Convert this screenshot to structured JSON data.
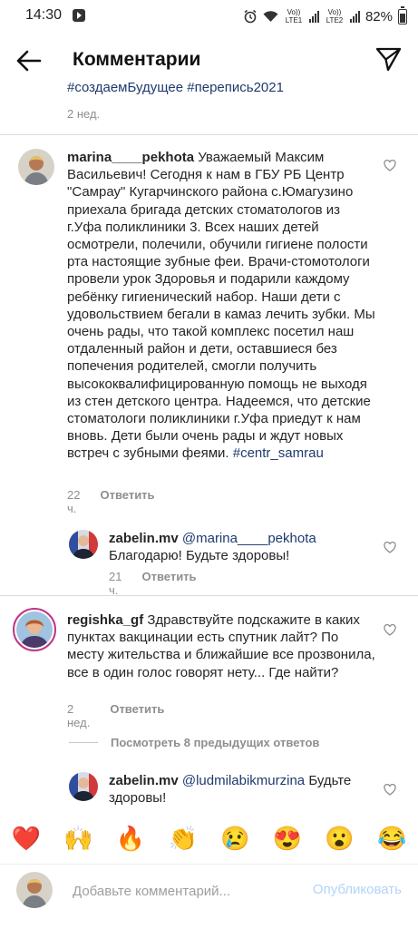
{
  "status": {
    "time": "14:30",
    "lte1": "Vo)) LTE1",
    "lte2": "Vo)) LTE2",
    "battery": "82%"
  },
  "header": {
    "title": "Комментарии"
  },
  "prev": {
    "tags": "#создаемБудущее #перепись2021",
    "time": "2 нед."
  },
  "comments": [
    {
      "username": "marina____pekhota",
      "text": " Уважаемый Максим Васильевич! Сегодня к нам в ГБУ РБ Центр \"Самрау\" Кугарчинского района с.Юмагузино приехала бригада детских стоматологов из г.Уфа поликлиники 3. Всех наших детей осмотрели, полечили, обучили гигиене полости рта настоящие зубные феи. Врачи-стомотологи провели урок Здоровья и подарили каждому ребёнку гигиенический набор. Наши дети с удовольствием бегали в камаз лечить зубки. Мы очень рады, что такой комплекс посетил наш отдаленный район  и дети, оставшиеся без попечения родителей, смогли получить высококвалифицированную помощь не выходя из стен детского центра. Надеемся, что детские стоматологи поликлиники г.Уфа приедут к нам вновь. Дети были очень рады и ждут новых встреч с зубными феями. ",
      "hashtag": "#centr_samrau",
      "time": "22 ч.",
      "reply": "Ответить"
    },
    {
      "username": "zabelin.mv",
      "mention": "@marina____pekhota",
      "text": "Благодарю! Будьте здоровы!",
      "time": "21 ч.",
      "reply": "Ответить"
    },
    {
      "username": "regishka_gf",
      "text": " Здравствуйте подскажите в каких пунктах вакцинации есть спутник лайт?  По месту жительства и ближайшие все прозвонила, все в один голос говорят нету... Где найти?",
      "time": "2 нед.",
      "reply": "Ответить"
    },
    {
      "username": "zabelin.mv",
      "mention": "@ludmilabikmurzina",
      "text": " Будьте здоровы!"
    }
  ],
  "view_previous": "Посмотреть 8 предыдущих ответов",
  "emojis": [
    "❤️",
    "🙌",
    "🔥",
    "👏",
    "😢",
    "😍",
    "😮",
    "😂"
  ],
  "input": {
    "placeholder": "Добавьте комментарий...",
    "publish": "Опубликовать"
  },
  "colors": {
    "link": "#1e3a6e",
    "meta": "#8e8e8e",
    "publish_disabled": "#b3d4f7"
  }
}
